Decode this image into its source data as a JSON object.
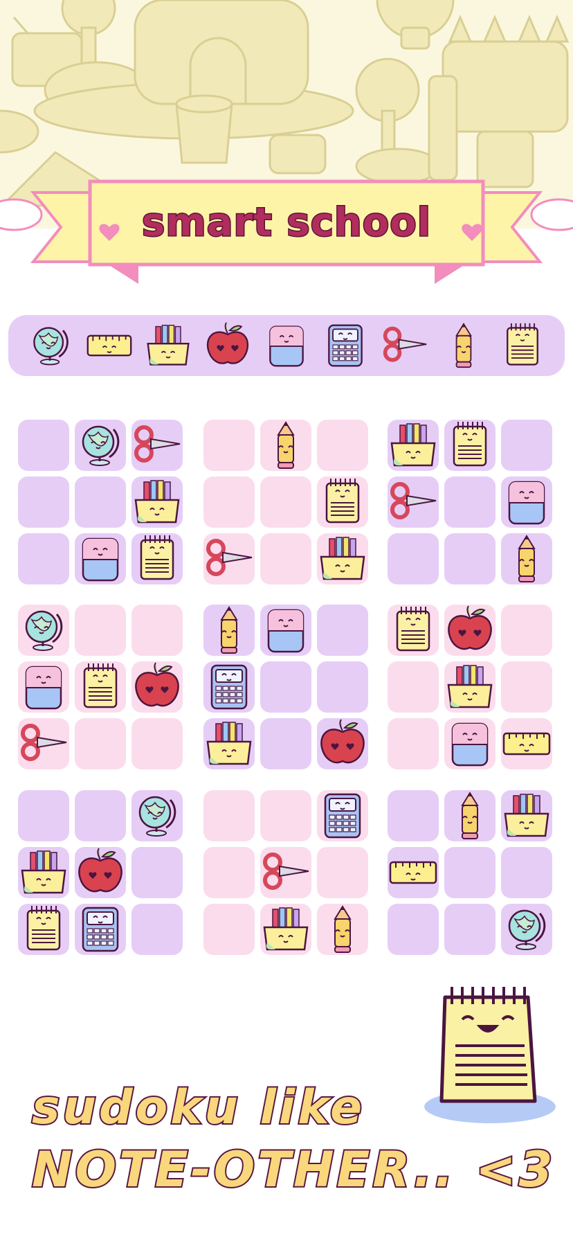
{
  "banner": {
    "title": "smart school"
  },
  "palette": {
    "items": [
      "globe-icon",
      "ruler-icon",
      "crayons-icon",
      "apple-icon",
      "eraser-icon",
      "calculator-icon",
      "scissors-icon",
      "pencil-icon",
      "notepad-icon"
    ]
  },
  "board": {
    "rows": [
      [
        "",
        "globe",
        "scissors",
        "",
        "pencil",
        "",
        "crayons",
        "notepad",
        ""
      ],
      [
        "",
        "",
        "crayons",
        "",
        "",
        "notepad",
        "scissors",
        "",
        "eraser"
      ],
      [
        "",
        "eraser",
        "notepad",
        "scissors",
        "",
        "crayons",
        "",
        "",
        "pencil"
      ],
      [
        "globe",
        "",
        "",
        "pencil",
        "eraser",
        "",
        "notepad",
        "apple",
        ""
      ],
      [
        "eraser",
        "notepad",
        "apple",
        "calculator",
        "",
        "",
        "",
        "crayons",
        ""
      ],
      [
        "scissors",
        "",
        "",
        "crayons",
        "",
        "apple",
        "",
        "eraser",
        "ruler"
      ],
      [
        "",
        "",
        "globe",
        "",
        "",
        "calculator",
        "",
        "pencil",
        "crayons"
      ],
      [
        "crayons",
        "apple",
        "",
        "",
        "scissors",
        "",
        "ruler",
        "",
        ""
      ],
      [
        "notepad",
        "calculator",
        "",
        "",
        "crayons",
        "pencil",
        "",
        "",
        "globe"
      ]
    ],
    "box_colors": [
      [
        "purple",
        "pink",
        "purple"
      ],
      [
        "pink",
        "purple",
        "pink"
      ],
      [
        "purple",
        "pink",
        "purple"
      ]
    ]
  },
  "caption": {
    "line1": "sudoku like",
    "line2": "NOTE-OTHER.. <3"
  },
  "colors": {
    "purple_cell": "#e6cdf6",
    "pink_cell": "#fbdcec",
    "banner_fill": "#fdf4a8",
    "banner_border": "#f28dbd",
    "title_color": "#b02d5e",
    "caption_fill": "#f8d77d",
    "outline": "#5a1740"
  }
}
